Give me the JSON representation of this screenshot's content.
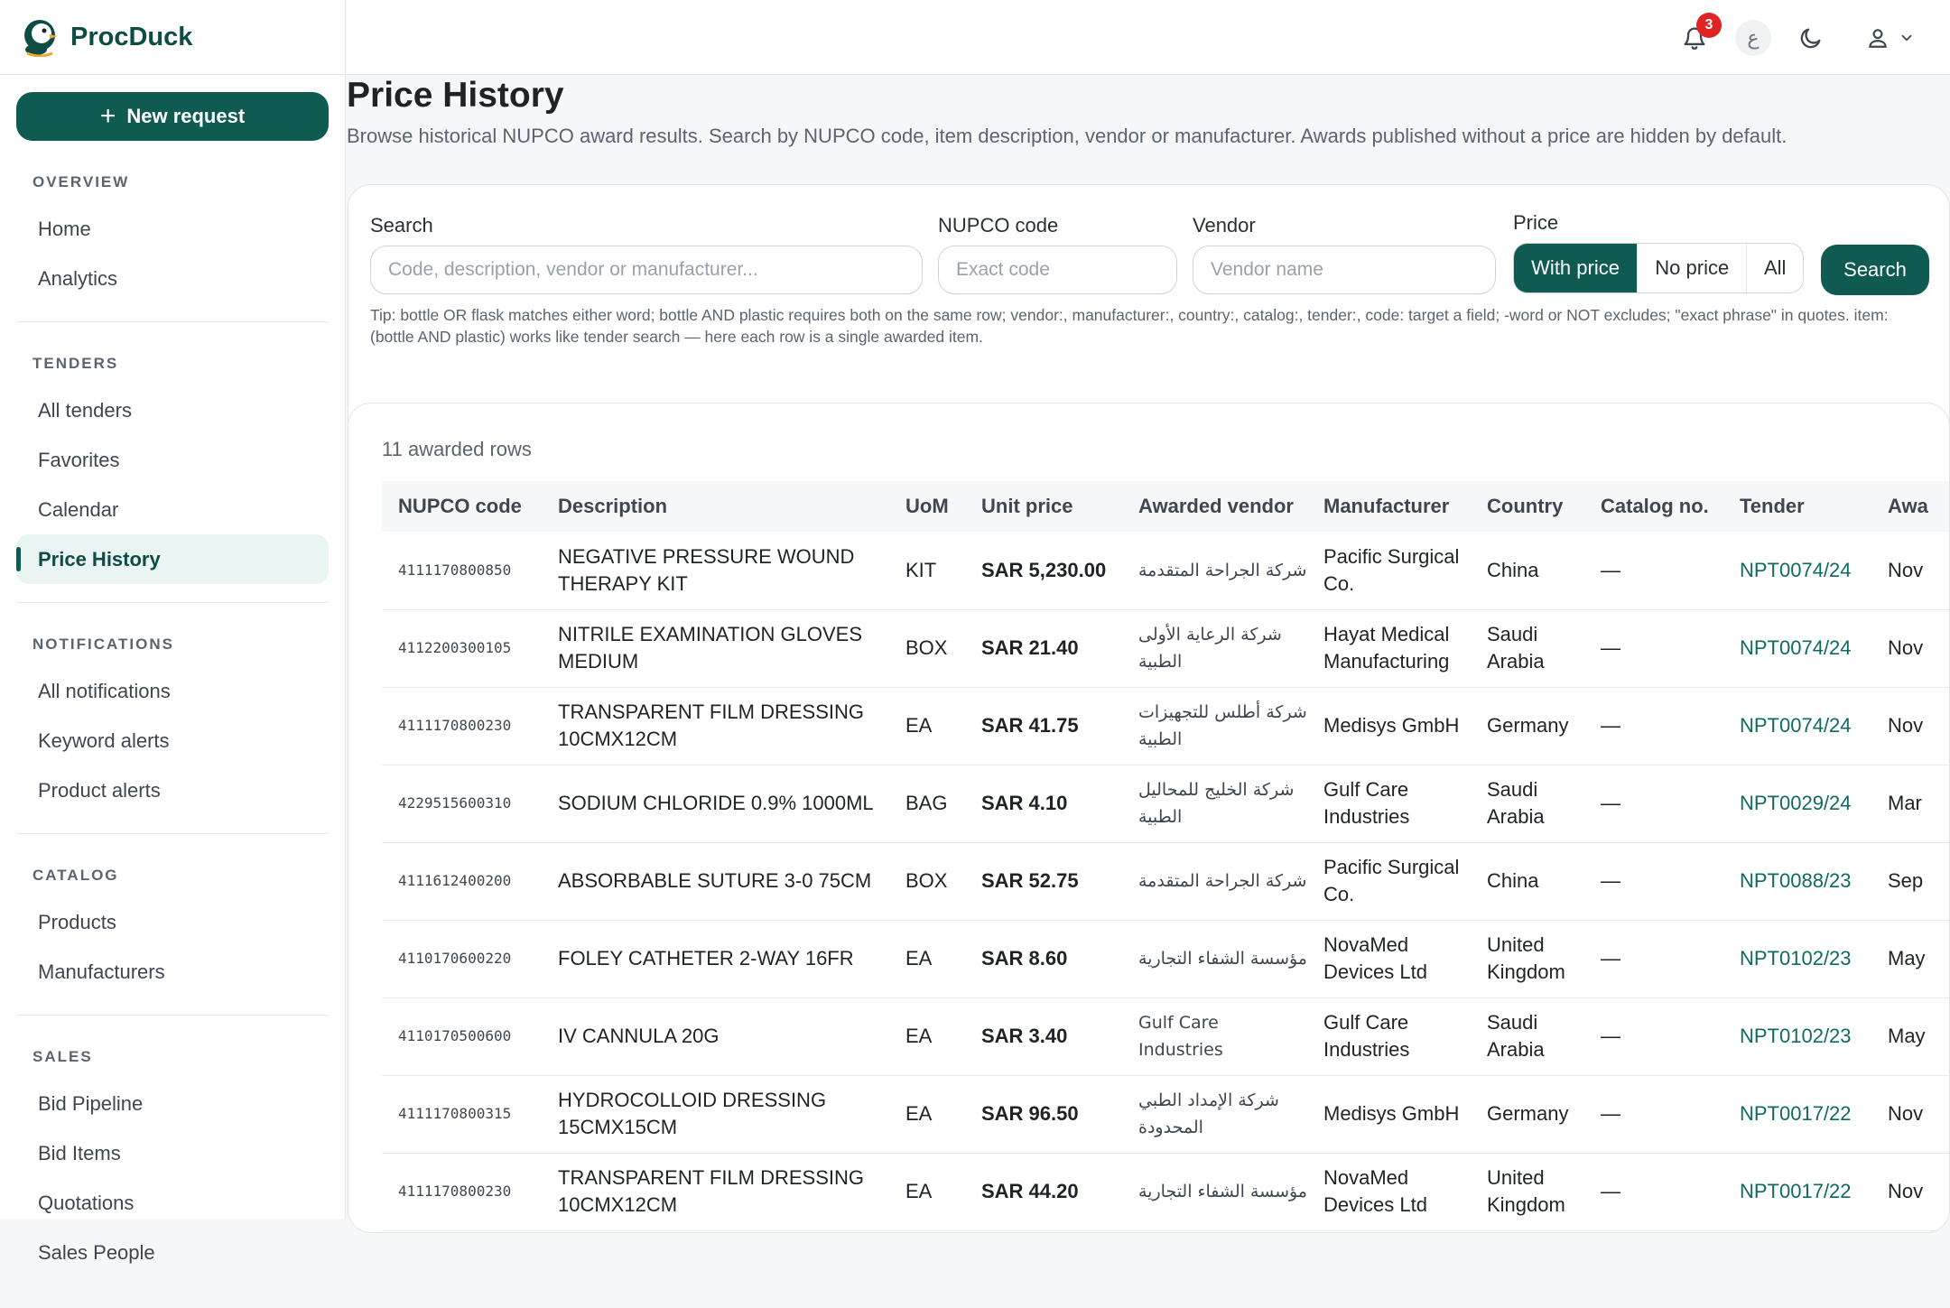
{
  "app": {
    "name": "ProcDuck"
  },
  "sidebar": {
    "new_request_label": "New request",
    "sections": [
      {
        "heading": "OVERVIEW",
        "items": [
          {
            "label": "Home"
          },
          {
            "label": "Analytics"
          }
        ]
      },
      {
        "heading": "TENDERS",
        "items": [
          {
            "label": "All tenders"
          },
          {
            "label": "Favorites"
          },
          {
            "label": "Calendar"
          },
          {
            "label": "Price History",
            "active": true
          }
        ]
      },
      {
        "heading": "NOTIFICATIONS",
        "items": [
          {
            "label": "All notifications"
          },
          {
            "label": "Keyword alerts"
          },
          {
            "label": "Product alerts"
          }
        ]
      },
      {
        "heading": "CATALOG",
        "items": [
          {
            "label": "Products"
          },
          {
            "label": "Manufacturers"
          }
        ]
      },
      {
        "heading": "SALES",
        "items": [
          {
            "label": "Bid Pipeline"
          },
          {
            "label": "Bid Items"
          },
          {
            "label": "Quotations"
          },
          {
            "label": "Sales People"
          }
        ]
      }
    ]
  },
  "topbar": {
    "notification_count": "3",
    "language_label": "ع",
    "icons": [
      "bell-icon",
      "language-icon",
      "moon-icon",
      "user-icon",
      "chevron-down-icon"
    ]
  },
  "page": {
    "title": "Price History",
    "subtitle": "Browse historical NUPCO award results. Search by NUPCO code, item description, vendor or manufacturer. Awards published without a price are hidden by default."
  },
  "filters": {
    "search_label": "Search",
    "search_placeholder": "Code, description, vendor or manufacturer...",
    "code_label": "NUPCO code",
    "code_placeholder": "Exact code",
    "vendor_label": "Vendor",
    "vendor_placeholder": "Vendor name",
    "price_label": "Price",
    "price_options": [
      "With price",
      "No price",
      "All"
    ],
    "price_selected": "With price",
    "search_button": "Search",
    "tip": "Tip: bottle OR flask matches either word; bottle AND plastic requires both on the same row; vendor:, manufacturer:, country:, catalog:, tender:, code: target a field; -word or NOT excludes; \"exact phrase\" in quotes. item:(bottle AND plastic) works like tender search — here each row is a single awarded item."
  },
  "results": {
    "count_label": "11 awarded rows",
    "columns": [
      "NUPCO code",
      "Description",
      "UoM",
      "Unit price",
      "Awarded vendor",
      "Manufacturer",
      "Country",
      "Catalog no.",
      "Tender",
      "Awa"
    ],
    "rows": [
      {
        "code": "4111170800850",
        "description": "NEGATIVE PRESSURE WOUND THERAPY KIT",
        "uom": "KIT",
        "price": "SAR 5,230.00",
        "vendor": "شركة الجراحة المتقدمة",
        "manufacturer": "Pacific Surgical Co.",
        "country": "China",
        "catalog": "—",
        "tender": "NPT0074/24",
        "award": "Nov"
      },
      {
        "code": "4112200300105",
        "description": "NITRILE EXAMINATION GLOVES MEDIUM",
        "uom": "BOX",
        "price": "SAR 21.40",
        "vendor": "شركة الرعاية الأولى الطبية",
        "manufacturer": "Hayat Medical Manufacturing",
        "country": "Saudi Arabia",
        "catalog": "—",
        "tender": "NPT0074/24",
        "award": "Nov"
      },
      {
        "code": "4111170800230",
        "description": "TRANSPARENT FILM DRESSING 10CMX12CM",
        "uom": "EA",
        "price": "SAR 41.75",
        "vendor": "شركة أطلس للتجهيزات الطبية",
        "manufacturer": "Medisys GmbH",
        "country": "Germany",
        "catalog": "—",
        "tender": "NPT0074/24",
        "award": "Nov"
      },
      {
        "code": "4229515600310",
        "description": "SODIUM CHLORIDE 0.9% 1000ML",
        "uom": "BAG",
        "price": "SAR 4.10",
        "vendor": "شركة الخليج للمحاليل الطبية",
        "manufacturer": "Gulf Care Industries",
        "country": "Saudi Arabia",
        "catalog": "—",
        "tender": "NPT0029/24",
        "award": "Mar"
      },
      {
        "code": "4111612400200",
        "description": "ABSORBABLE SUTURE 3-0 75CM",
        "uom": "BOX",
        "price": "SAR 52.75",
        "vendor": "شركة الجراحة المتقدمة",
        "manufacturer": "Pacific Surgical Co.",
        "country": "China",
        "catalog": "—",
        "tender": "NPT0088/23",
        "award": "Sep"
      },
      {
        "code": "4110170600220",
        "description": "FOLEY CATHETER 2-WAY 16FR",
        "uom": "EA",
        "price": "SAR 8.60",
        "vendor": "مؤسسة الشفاء التجارية",
        "manufacturer": "NovaMed Devices Ltd",
        "country": "United Kingdom",
        "catalog": "—",
        "tender": "NPT0102/23",
        "award": "May"
      },
      {
        "code": "4110170500600",
        "description": "IV CANNULA 20G",
        "uom": "EA",
        "price": "SAR 3.40",
        "vendor": "Gulf Care Industries",
        "manufacturer": "Gulf Care Industries",
        "country": "Saudi Arabia",
        "catalog": "—",
        "tender": "NPT0102/23",
        "award": "May"
      },
      {
        "code": "4111170800315",
        "description": "HYDROCOLLOID DRESSING 15CMX15CM",
        "uom": "EA",
        "price": "SAR 96.50",
        "vendor": "شركة الإمداد الطبي المحدودة",
        "manufacturer": "Medisys GmbH",
        "country": "Germany",
        "catalog": "—",
        "tender": "NPT0017/22",
        "award": "Nov"
      },
      {
        "code": "4111170800230",
        "description": "TRANSPARENT FILM DRESSING 10CMX12CM",
        "uom": "EA",
        "price": "SAR 44.20",
        "vendor": "مؤسسة الشفاء التجارية",
        "manufacturer": "NovaMed Devices Ltd",
        "country": "United Kingdom",
        "catalog": "—",
        "tender": "NPT0017/22",
        "award": "Nov"
      }
    ]
  },
  "colors": {
    "primary": "#0f5b52",
    "link": "#0f6b5f",
    "badge": "#e02424"
  }
}
